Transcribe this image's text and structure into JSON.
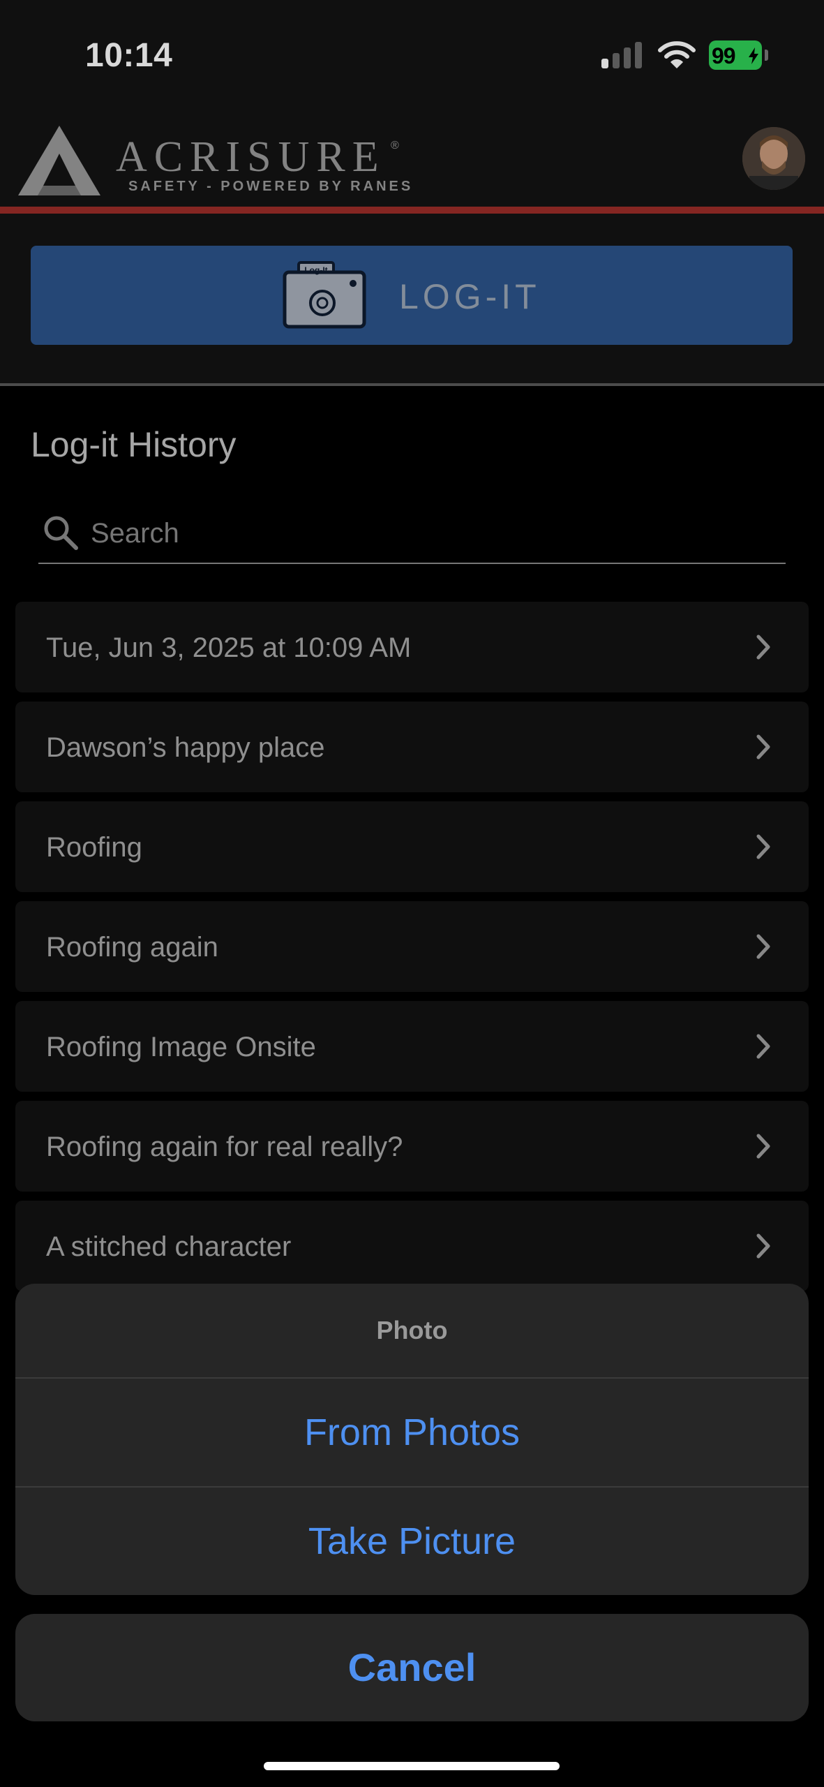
{
  "status_bar": {
    "time": "10:14",
    "battery": "99",
    "battery_color": "#30d158"
  },
  "header": {
    "brand_name": "ACRISURE",
    "brand_mark": "®",
    "tagline": "SAFETY - POWERED BY RANES",
    "accent_color": "#9d2d28"
  },
  "logit": {
    "button_label": "LOG-IT",
    "icon_label": "Log-It",
    "button_color": "#2c548b"
  },
  "history": {
    "title": "Log-it History",
    "search_placeholder": "Search",
    "items": [
      {
        "label": "Tue, Jun 3, 2025 at 10:09 AM"
      },
      {
        "label": "Dawson’s happy place"
      },
      {
        "label": "Roofing"
      },
      {
        "label": "Roofing again"
      },
      {
        "label": "Roofing Image Onsite"
      },
      {
        "label": "Roofing again for real really?"
      },
      {
        "label": "A stitched character"
      }
    ]
  },
  "action_sheet": {
    "title": "Photo",
    "actions": [
      "From Photos",
      "Take Picture"
    ],
    "cancel": "Cancel",
    "action_color": "#4e90f1"
  },
  "icons": [
    "signal-icon",
    "wifi-icon",
    "battery-icon",
    "camera-icon",
    "search-icon",
    "chevron-right-icon",
    "avatar"
  ]
}
